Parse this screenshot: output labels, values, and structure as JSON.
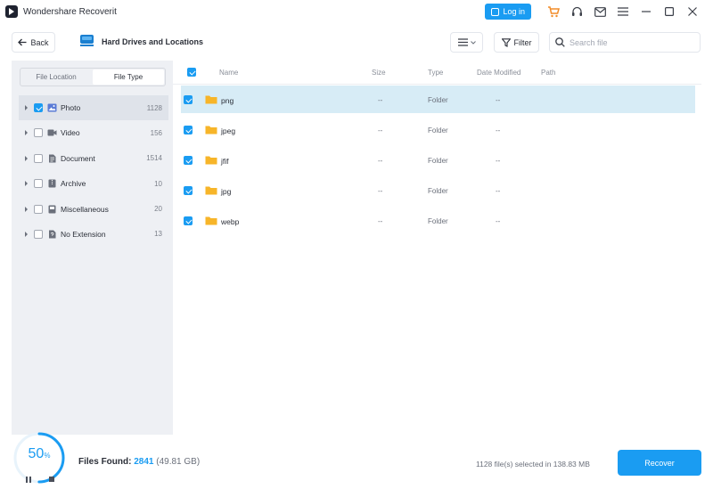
{
  "app": {
    "title": "Wondershare Recoverit"
  },
  "titlebar": {
    "login_label": "Log in"
  },
  "header": {
    "back_label": "Back",
    "location_title": "Hard Drives and Locations",
    "filter_label": "Filter",
    "search_placeholder": "Search file"
  },
  "sidebar": {
    "tabs": [
      {
        "label": "File Location",
        "active": false
      },
      {
        "label": "File Type",
        "active": true
      }
    ],
    "items": [
      {
        "label": "Photo",
        "count": "1128",
        "checked": true,
        "selected": true,
        "icon": "photo-icon"
      },
      {
        "label": "Video",
        "count": "156",
        "checked": false,
        "selected": false,
        "icon": "video-icon"
      },
      {
        "label": "Document",
        "count": "1514",
        "checked": false,
        "selected": false,
        "icon": "document-icon"
      },
      {
        "label": "Archive",
        "count": "10",
        "checked": false,
        "selected": false,
        "icon": "archive-icon"
      },
      {
        "label": "Miscellaneous",
        "count": "20",
        "checked": false,
        "selected": false,
        "icon": "misc-icon"
      },
      {
        "label": "No Extension",
        "count": "13",
        "checked": false,
        "selected": false,
        "icon": "file-icon"
      }
    ]
  },
  "table": {
    "columns": [
      "Name",
      "Size",
      "Type",
      "Date Modified",
      "Path"
    ],
    "rows": [
      {
        "name": "png",
        "size": "--",
        "type": "Folder",
        "date": "--",
        "path": "",
        "checked": true,
        "selected": true
      },
      {
        "name": "jpeg",
        "size": "--",
        "type": "Folder",
        "date": "--",
        "path": "",
        "checked": true,
        "selected": false
      },
      {
        "name": "jfif",
        "size": "--",
        "type": "Folder",
        "date": "--",
        "path": "",
        "checked": true,
        "selected": false
      },
      {
        "name": "jpg",
        "size": "--",
        "type": "Folder",
        "date": "--",
        "path": "",
        "checked": true,
        "selected": false
      },
      {
        "name": "webp",
        "size": "--",
        "type": "Folder",
        "date": "--",
        "path": "",
        "checked": true,
        "selected": false
      }
    ]
  },
  "footer": {
    "progress_value": "50",
    "progress_unit": "%",
    "progress_fraction": 0.5,
    "files_found_label": "Files Found:",
    "files_found_count": "2841",
    "files_found_size": "(49.81 GB)",
    "selected_info": "1128 file(s) selected in 138.83 MB",
    "recover_label": "Recover"
  },
  "colors": {
    "accent": "#1a9cf2",
    "folder": "#f7b529",
    "selected_row": "#d7ecf6"
  }
}
